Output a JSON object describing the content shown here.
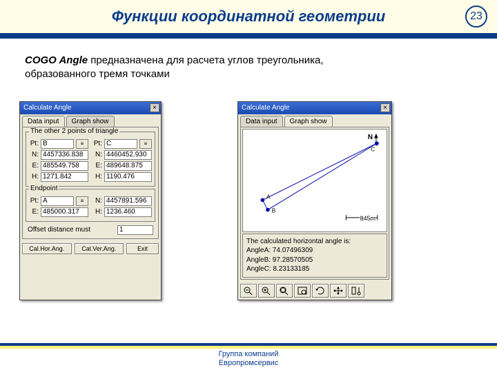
{
  "page": {
    "title": "Функции координатной геометрии",
    "number": "23"
  },
  "desc": {
    "lead": "COGO Angle",
    "rest": " предназначена для расчета углов треугольника, образованного тремя точками"
  },
  "win1": {
    "title": "Calculate Angle",
    "tabs": {
      "a": "Data input",
      "b": "Graph show"
    },
    "groupA": {
      "title": "The other 2 points of  triangle",
      "ptB": {
        "lbl": "Pt:",
        "val": "B"
      },
      "ptC": {
        "lbl": "Pt:",
        "val": "C"
      },
      "Nb": {
        "lbl": "N:",
        "val": "4457336.838"
      },
      "Nc": {
        "lbl": "N:",
        "val": "4460452.930"
      },
      "Eb": {
        "lbl": "E:",
        "val": "485549.758"
      },
      "Ec": {
        "lbl": "E:",
        "val": "489648.875"
      },
      "Hb": {
        "lbl": "H:",
        "val": "1271.842"
      },
      "Hc": {
        "lbl": "H:",
        "val": "1190.476"
      }
    },
    "groupB": {
      "title": "Endpoint",
      "ptA": {
        "lbl": "Pt:",
        "val": "A"
      },
      "Na": {
        "lbl": "N:",
        "val": "4457891.596"
      },
      "Ea": {
        "lbl": "E:",
        "val": "485000.317"
      },
      "Ha": {
        "lbl": "H:",
        "val": "1236.460"
      }
    },
    "offset": {
      "label": "Offset distance must",
      "val": "1"
    },
    "buttons": {
      "cha": "Cal.Hor.Ang.",
      "cva": "Cal.Ver.Ang.",
      "exit": "Exit"
    }
  },
  "win2": {
    "title": "Calculate Angle",
    "tabs": {
      "a": "Data input",
      "b": "Graph show"
    },
    "graph": {
      "north": "N",
      "pointA": "A",
      "pointB": "B",
      "pointC": "C",
      "dist": "845m"
    },
    "results": {
      "head": "The calculated horizontal angle is:",
      "a": "AngleA: 74.07496309",
      "b": "AngleB: 97.28570505",
      "c": "AngleC: 8.23133185"
    }
  },
  "footer": {
    "l1": "Группа компаний",
    "l2": "Европромсервис"
  }
}
